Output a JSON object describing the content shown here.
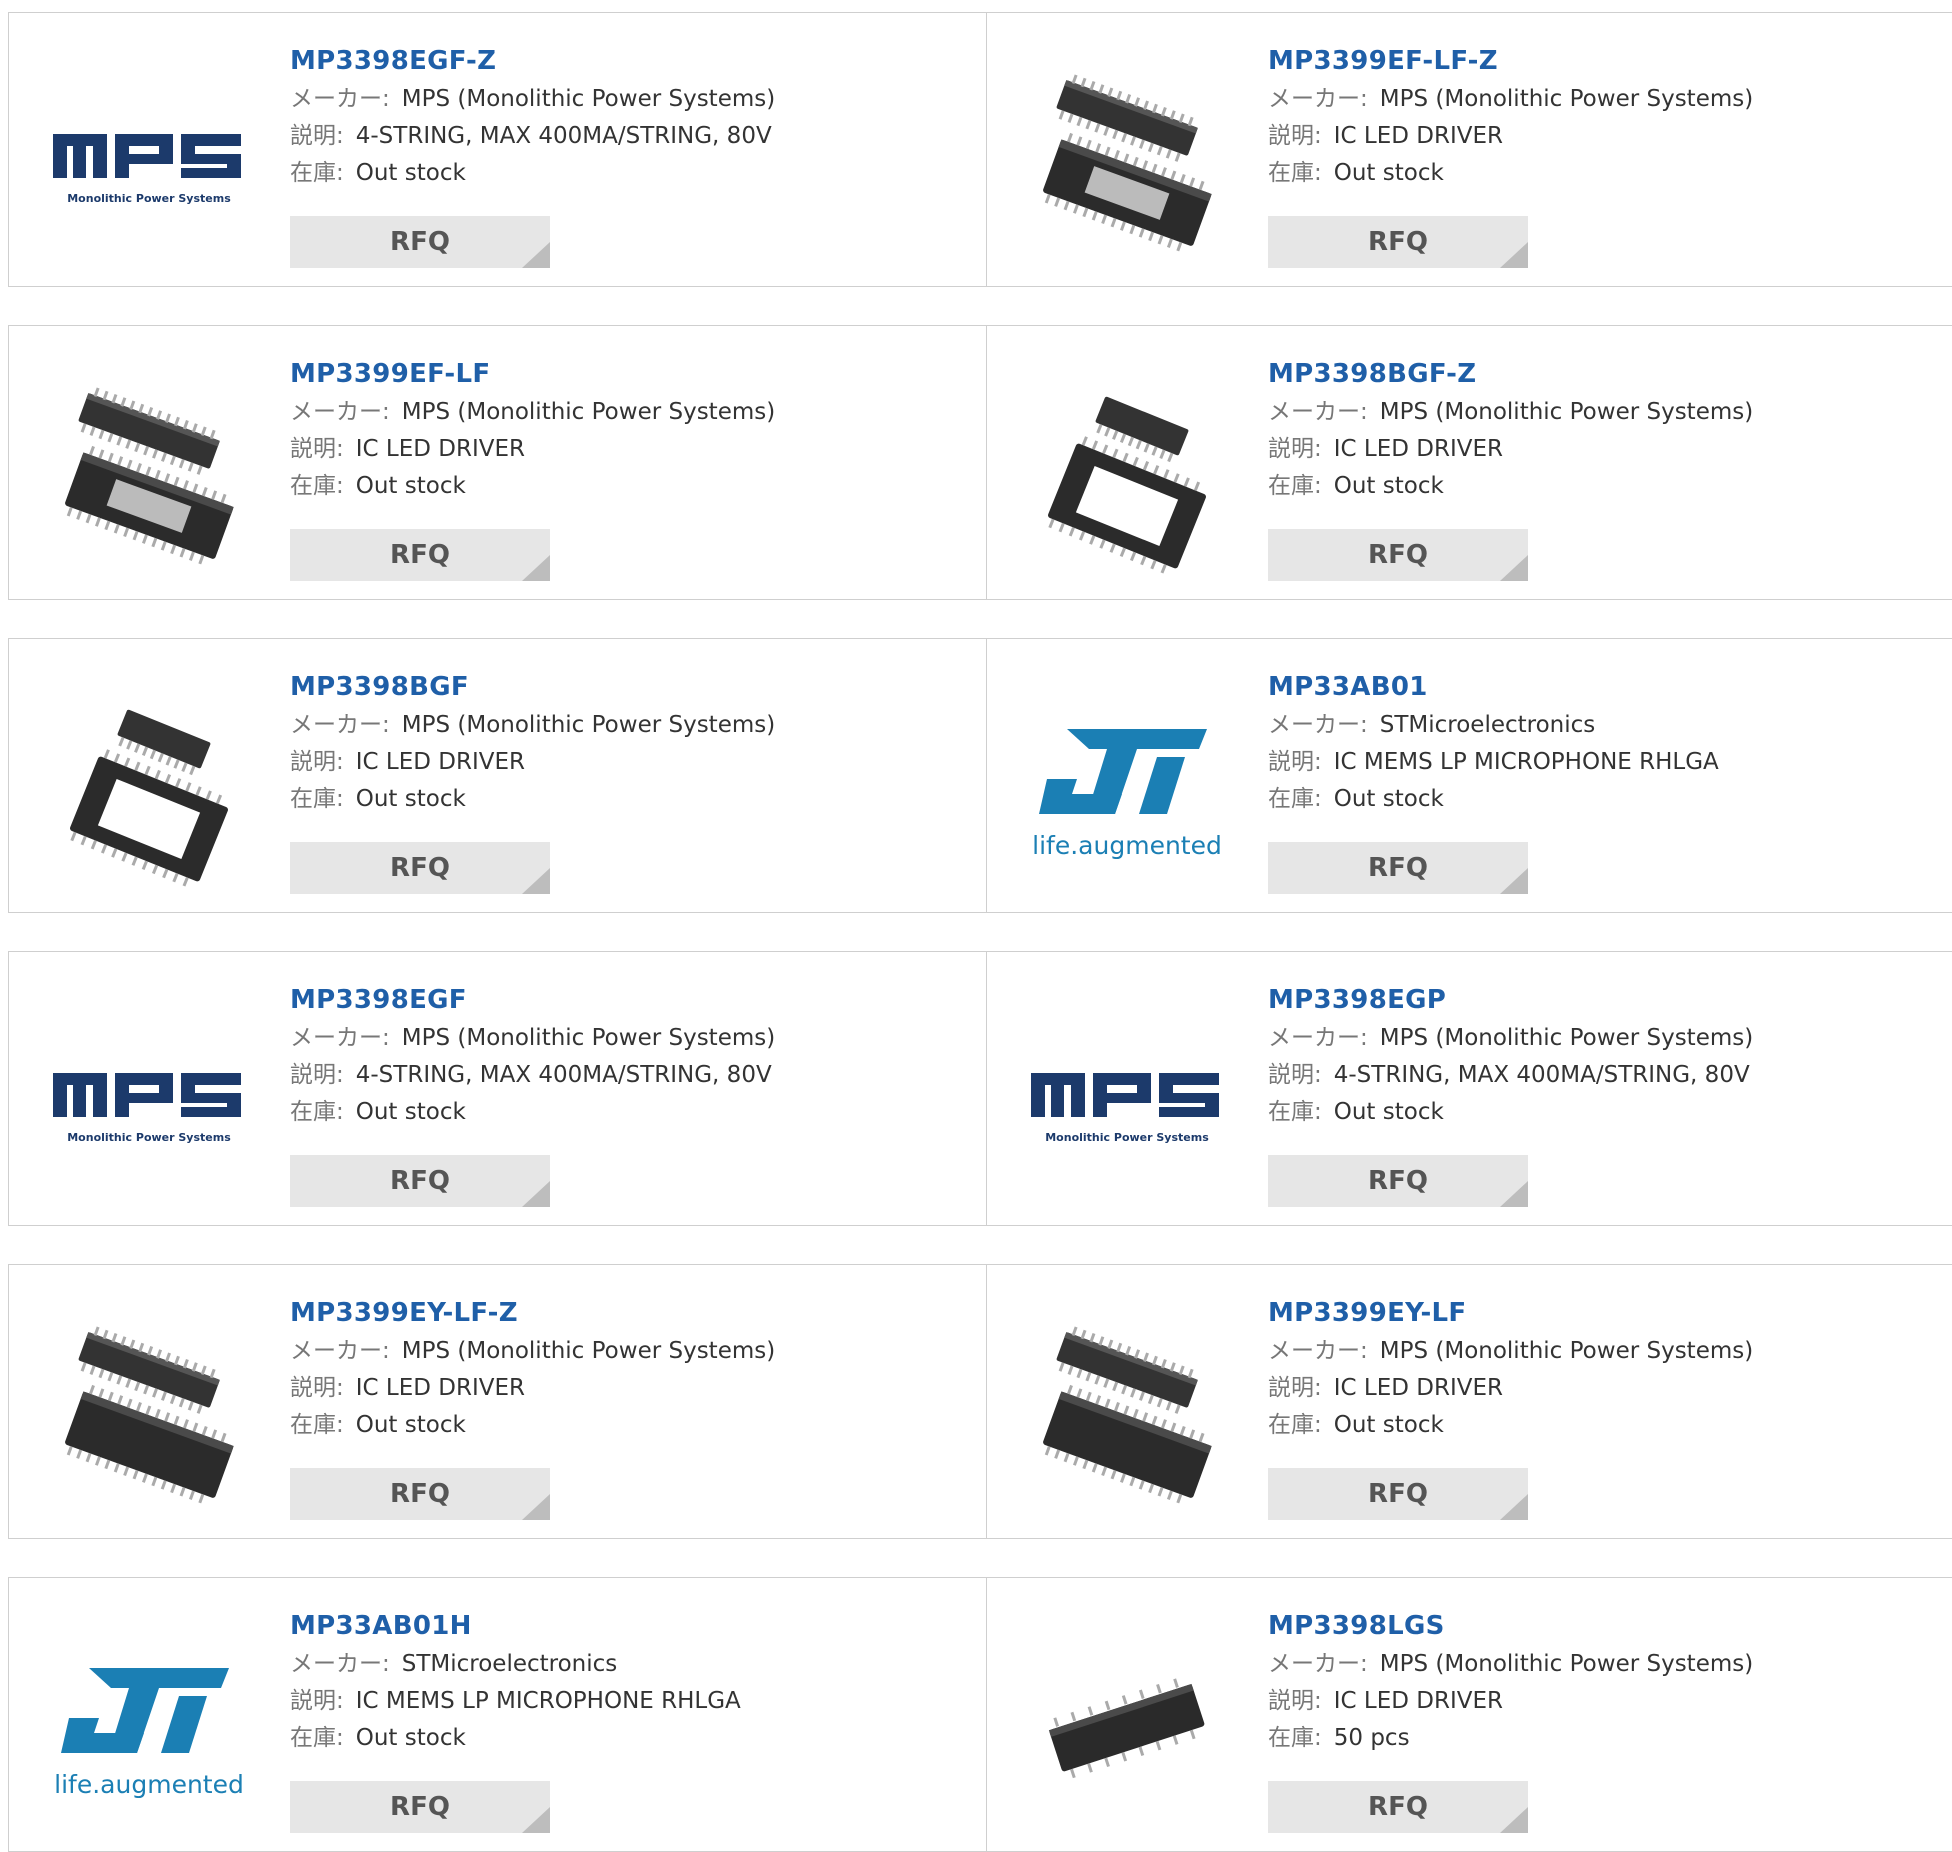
{
  "labels": {
    "maker": "メーカー:",
    "description": "説明:",
    "stock": "在庫:",
    "rfq": "RFQ"
  },
  "products": [
    {
      "name": "MP3398EGF-Z",
      "maker": "MPS (Monolithic Power Systems)",
      "description": "4-STRING, MAX 400MA/STRING, 80V",
      "stock": "Out stock",
      "image": "mps-logo",
      "logo_text": "Monolithic Power Systems"
    },
    {
      "name": "MP3399EF-LF-Z",
      "maker": "MPS (Monolithic Power Systems)",
      "description": "IC LED DRIVER",
      "stock": "Out stock",
      "image": "tssop-chip-icon"
    },
    {
      "name": "MP3399EF-LF",
      "maker": "MPS (Monolithic Power Systems)",
      "description": "IC LED DRIVER",
      "stock": "Out stock",
      "image": "tssop-chip-icon"
    },
    {
      "name": "MP3398BGF-Z",
      "maker": "MPS (Monolithic Power Systems)",
      "description": "IC LED DRIVER",
      "stock": "Out stock",
      "image": "tssop-small-chip-icon"
    },
    {
      "name": "MP3398BGF",
      "maker": "MPS (Monolithic Power Systems)",
      "description": "IC LED DRIVER",
      "stock": "Out stock",
      "image": "tssop-small-chip-icon"
    },
    {
      "name": "MP33AB01",
      "maker": "STMicroelectronics",
      "description": "IC MEMS LP MICROPHONE RHLGA",
      "stock": "Out stock",
      "image": "st-logo",
      "logo_text": "life.augmented"
    },
    {
      "name": "MP3398EGF",
      "maker": "MPS (Monolithic Power Systems)",
      "description": "4-STRING, MAX 400MA/STRING, 80V",
      "stock": "Out stock",
      "image": "mps-logo",
      "logo_text": "Monolithic Power Systems"
    },
    {
      "name": "MP3398EGP",
      "maker": "MPS (Monolithic Power Systems)",
      "description": "4-STRING, MAX 400MA/STRING, 80V",
      "stock": "Out stock",
      "image": "mps-logo",
      "logo_text": "Monolithic Power Systems"
    },
    {
      "name": "MP3399EY-LF-Z",
      "maker": "MPS (Monolithic Power Systems)",
      "description": "IC LED DRIVER",
      "stock": "Out stock",
      "image": "ssop-chip-icon"
    },
    {
      "name": "MP3399EY-LF",
      "maker": "MPS (Monolithic Power Systems)",
      "description": "IC LED DRIVER",
      "stock": "Out stock",
      "image": "ssop-chip-icon"
    },
    {
      "name": "MP33AB01H",
      "maker": "STMicroelectronics",
      "description": "IC MEMS LP MICROPHONE RHLGA",
      "stock": "Out stock",
      "image": "st-logo",
      "logo_text": "life.augmented"
    },
    {
      "name": "MP3398LGS",
      "maker": "MPS (Monolithic Power Systems)",
      "description": "IC LED DRIVER",
      "stock": "50 pcs",
      "image": "soic-chip-icon"
    }
  ],
  "colors": {
    "link": "#1f5fa8",
    "mps_navy": "#1c3a6b",
    "st_blue": "#1b7fb4",
    "button_bg": "#e6e6e6"
  }
}
